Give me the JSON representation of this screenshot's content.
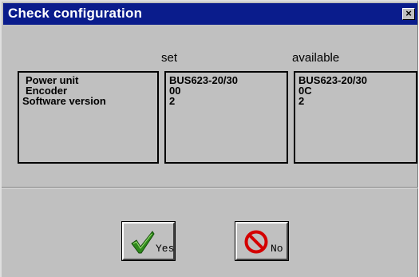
{
  "window": {
    "title": "Check configuration",
    "close_icon": "close-icon",
    "close_glyph": "×"
  },
  "columns": {
    "set_header": "set",
    "available_header": "available"
  },
  "labels": [
    "Power unit",
    "Encoder",
    "Software version"
  ],
  "set_values": [
    "BUS623-20/30",
    "00",
    "2"
  ],
  "available_values": [
    "BUS623-20/30",
    "0C",
    "2"
  ],
  "buttons": {
    "yes_label": "Yes",
    "yes_icon": "checkmark-icon",
    "no_label": "No",
    "no_icon": "no-sign-icon"
  },
  "colors": {
    "titlebar": "#0a1c8c",
    "face": "#c0c0c0",
    "check": "#2f8a1c",
    "no_sign": "#d40000"
  }
}
